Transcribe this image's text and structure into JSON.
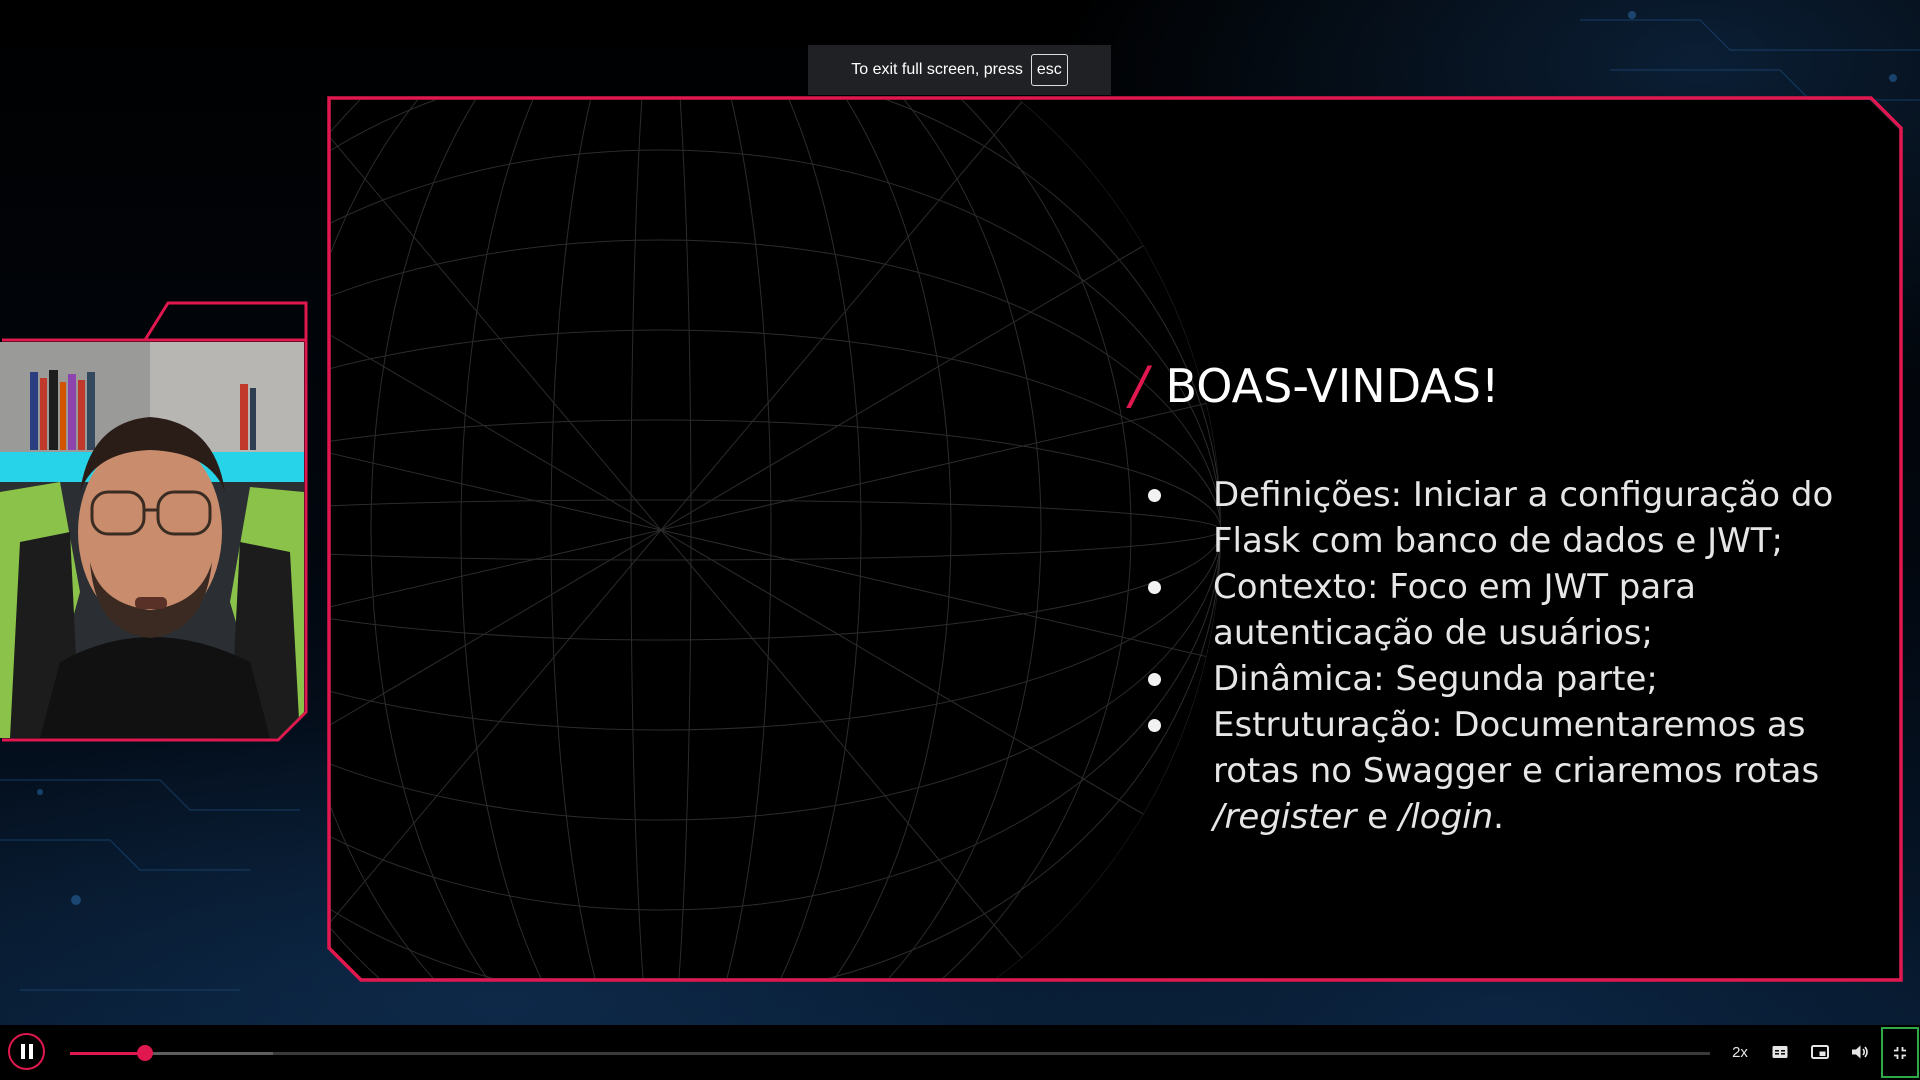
{
  "fullscreen_notice": {
    "text": "To exit full screen, press",
    "key": "esc"
  },
  "slide": {
    "title_slash": "/",
    "title": "BOAS-VINDAS!",
    "bullets": [
      {
        "text": "Definições: Iniciar a configuração do Flask com banco de dados e JWT;"
      },
      {
        "text": "Contexto: Foco em JWT para autenticação de usuários;"
      },
      {
        "text": "Dinâmica: Segunda parte;"
      },
      {
        "text_before": "Estruturação: Documentaremos as rotas no Swagger e criaremos rotas ",
        "route_register": "/register",
        "conjunction": " e ",
        "route_login": "/login",
        "text_after": "."
      }
    ]
  },
  "player": {
    "state": "playing",
    "progress": 0.046,
    "buffered": 0.124,
    "speed_label": "2x",
    "icons": {
      "play_pause": "pause-icon",
      "captions": "captions-icon",
      "picture_in_picture": "picture-in-picture-icon",
      "volume": "volume-icon",
      "fullscreen": "exit-fullscreen-icon"
    }
  },
  "colors": {
    "accent": "#e0184f",
    "fullscreen_focus": "#2ea94a",
    "toast_bg": "#202124"
  }
}
